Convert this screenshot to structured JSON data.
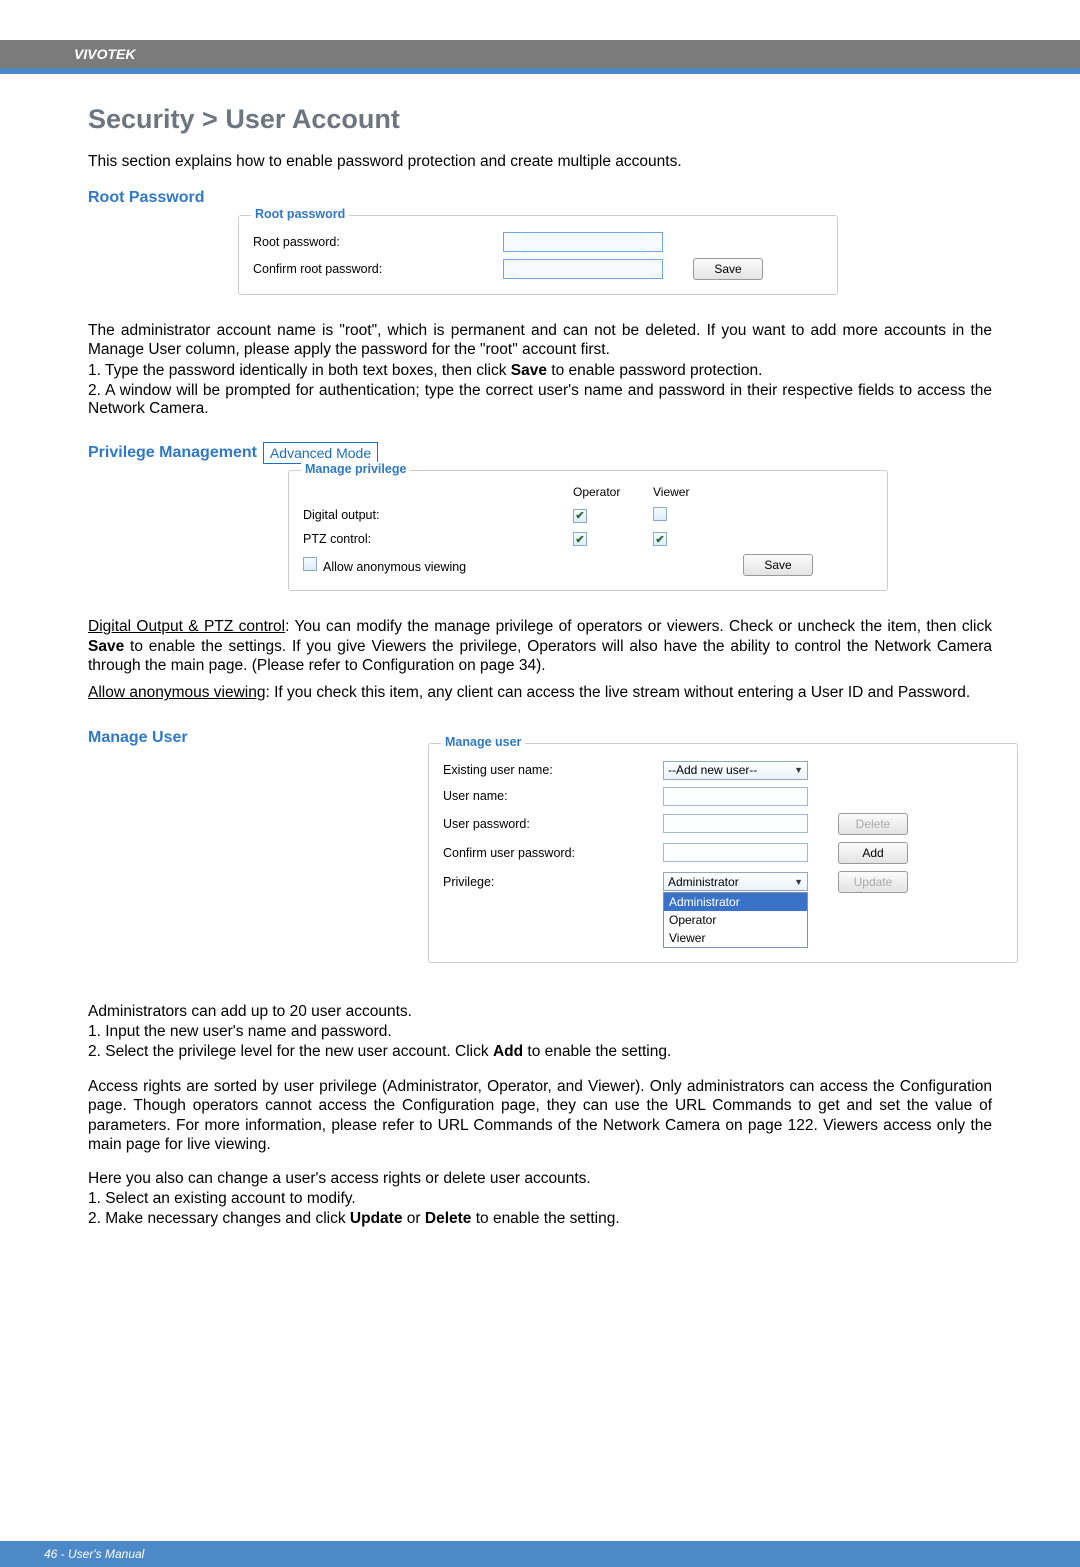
{
  "header": {
    "brand": "VIVOTEK"
  },
  "title": "Security > User Account",
  "intro": "This section explains how to enable password protection and create multiple accounts.",
  "root_password": {
    "heading": "Root Password",
    "legend": "Root password",
    "row1": "Root password:",
    "row2": "Confirm root password:",
    "save": "Save"
  },
  "root_desc_p1": "The administrator account name is \"root\", which is permanent and can not be deleted. If you want to add more accounts in the Manage User column, please apply the password for the \"root\" account first.",
  "root_desc_l1": "1. Type the password identically in both text boxes, then click ",
  "root_desc_l1b": "Save",
  "root_desc_l1c": " to enable password protection.",
  "root_desc_l2": "2. A window will be prompted for authentication; type the correct user's name and password in their respective fields to access the Network Camera.",
  "priv": {
    "heading": "Privilege Management",
    "badge": "Advanced Mode",
    "legend": "Manage privilege",
    "col_op": "Operator",
    "col_vw": "Viewer",
    "row_do": "Digital output:",
    "row_ptz": "PTZ control:",
    "row_anon": "Allow anonymous viewing",
    "save": "Save"
  },
  "priv_desc_head": "Digital Output & PTZ control",
  "priv_desc_body1": ": You can modify the manage privilege of operators or viewers. Check or uncheck the item, then click ",
  "priv_desc_save": "Save",
  "priv_desc_body2": " to enable the settings. If you give Viewers the privilege, Operators will also have the ability to control the Network Camera through the main page. (Please refer to Configuration on page 34).",
  "anon_head": "Allow anonymous viewing",
  "anon_body": ": If you check this item, any client can access the live stream without entering a User ID and Password.",
  "manage_user": {
    "heading": "Manage User",
    "legend": "Manage user",
    "existing": "Existing user name:",
    "existing_val": "--Add new user--",
    "uname": "User name:",
    "upw": "User password:",
    "cpw": "Confirm user password:",
    "priv": "Privilege:",
    "priv_val": "Administrator",
    "delete": "Delete",
    "add": "Add",
    "update": "Update",
    "opts": [
      "Administrator",
      "Operator",
      "Viewer"
    ]
  },
  "mu_p1": "Administrators can add up to 20 user accounts.",
  "mu_p2": "1. Input the new user's name and password.",
  "mu_p3a": "2. Select the privilege level for the new user account. Click ",
  "mu_p3b": "Add",
  "mu_p3c": " to enable the setting.",
  "mu_p4": "Access rights are sorted by user privilege (Administrator, Operator, and Viewer). Only administrators can access the Configuration page. Though operators cannot access the Configuration page, they can use the URL Commands to get and set the value of parameters. For more information, please refer to URL Commands of the Network Camera on page 122. Viewers access only the main page for live viewing.",
  "mu_p5": "Here you also can change a user's access rights or delete user accounts.",
  "mu_p6": "1. Select an existing account to modify.",
  "mu_p7a": "2. Make necessary changes and click ",
  "mu_p7b": "Update",
  "mu_p7c": " or ",
  "mu_p7d": "Delete",
  "mu_p7e": " to enable the setting.",
  "footer": "46 - User's Manual"
}
